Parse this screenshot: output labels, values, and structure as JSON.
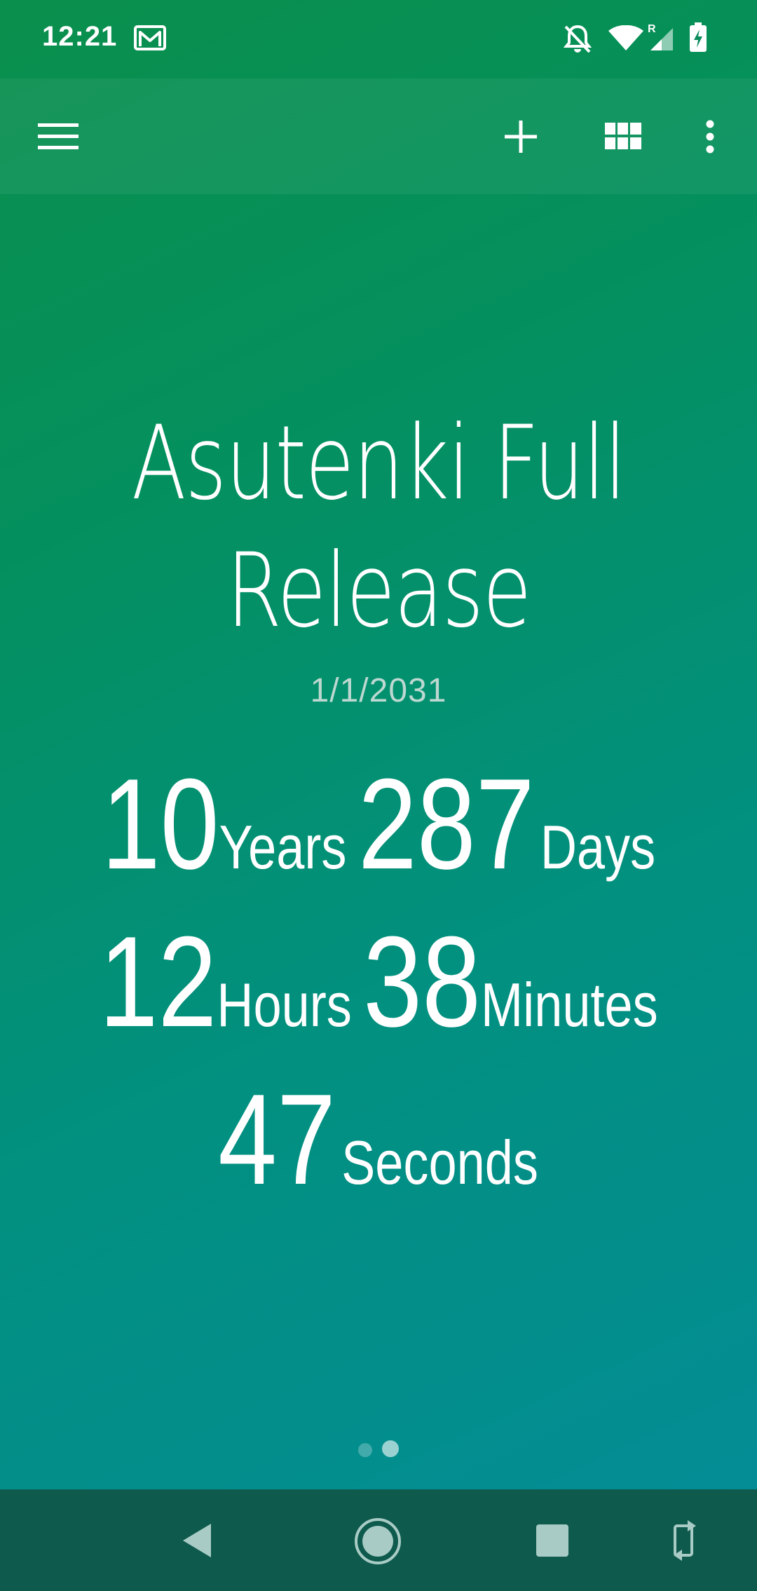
{
  "status_bar": {
    "time": "12:21",
    "icons": [
      "gmail-icon",
      "notifications-off-icon",
      "wifi-icon",
      "signal-icon",
      "battery-charging-icon"
    ],
    "signal_roaming_label": "R"
  },
  "toolbar": {
    "icons": [
      "menu-icon",
      "add-icon",
      "grid-icon",
      "more-vert-icon"
    ]
  },
  "countdown": {
    "title_line1": "Asutenki Full",
    "title_line2": "Release",
    "date": "1/1/2031",
    "years_value": "10",
    "years_label": "Years",
    "days_value": "287",
    "days_label": "Days",
    "hours_value": "12",
    "hours_label": "Hours",
    "minutes_value": "38",
    "minutes_label": "Minutes",
    "seconds_value": "47",
    "seconds_label": "Seconds"
  },
  "pager": {
    "pages": 2,
    "active_page": 2
  },
  "nav_bar": {
    "icons": [
      "back-icon",
      "home-icon",
      "recents-icon",
      "rotate-icon"
    ]
  },
  "colors": {
    "gradient_start": "#0a8f4c",
    "gradient_end": "#048c98",
    "nav_bar": "#0e5a4d",
    "date_text": "#bcd8d0"
  }
}
